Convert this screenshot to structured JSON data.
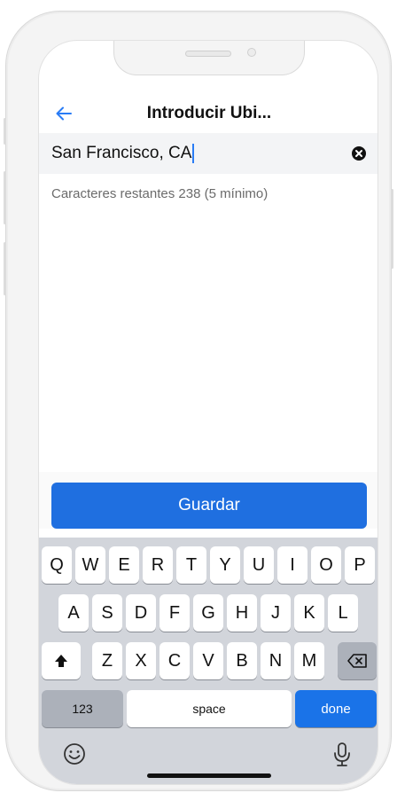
{
  "header": {
    "title": "Introducir Ubi...",
    "back_icon": "arrow-left-icon"
  },
  "location_input": {
    "value": "San Francisco, CA",
    "clear_icon": "close-circle-icon"
  },
  "helper_text": "Caracteres restantes 238 (5 mínimo)",
  "save_button": {
    "label": "Guardar"
  },
  "keyboard": {
    "row1": [
      "Q",
      "W",
      "E",
      "R",
      "T",
      "Y",
      "U",
      "I",
      "O",
      "P"
    ],
    "row2": [
      "A",
      "S",
      "D",
      "F",
      "G",
      "H",
      "J",
      "K",
      "L"
    ],
    "row3": [
      "Z",
      "X",
      "C",
      "V",
      "B",
      "N",
      "M"
    ],
    "shift_icon": "shift-arrow-icon",
    "delete_icon": "backspace-icon",
    "numbers_label": "123",
    "space_label": "space",
    "done_label": "done",
    "emoji_icon": "emoji-icon",
    "mic_icon": "microphone-icon"
  },
  "colors": {
    "accent": "#1f6fe0",
    "done_key": "#1a73e8",
    "keyboard_bg": "#d2d5db",
    "back_arrow": "#2a7cf5"
  }
}
